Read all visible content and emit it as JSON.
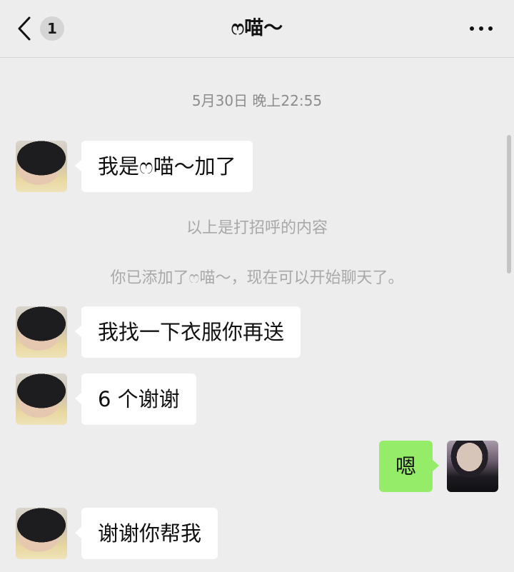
{
  "header": {
    "unread_count": "1",
    "title": "ෆ喵～"
  },
  "chat": {
    "timestamp": "5月30日 晚上22:55",
    "messages": [
      {
        "side": "left",
        "text": "我是ෆ喵～加了"
      },
      {
        "side": "system",
        "text": "以上是打招呼的内容"
      },
      {
        "side": "system",
        "text": "你已添加了ෆ喵～，现在可以开始聊天了。"
      },
      {
        "side": "left",
        "text": "我找一下衣服你再送"
      },
      {
        "side": "left",
        "text": "6 个谢谢"
      },
      {
        "side": "right",
        "text": "嗯"
      },
      {
        "side": "left",
        "text": "谢谢你帮我"
      }
    ]
  },
  "icons": {
    "back": "chevron-left-icon",
    "more": "more-horizontal-icon"
  },
  "colors": {
    "background": "#ededed",
    "bubble_incoming": "#ffffff",
    "bubble_outgoing": "#95ec69",
    "system_text": "#a8a8a8"
  }
}
